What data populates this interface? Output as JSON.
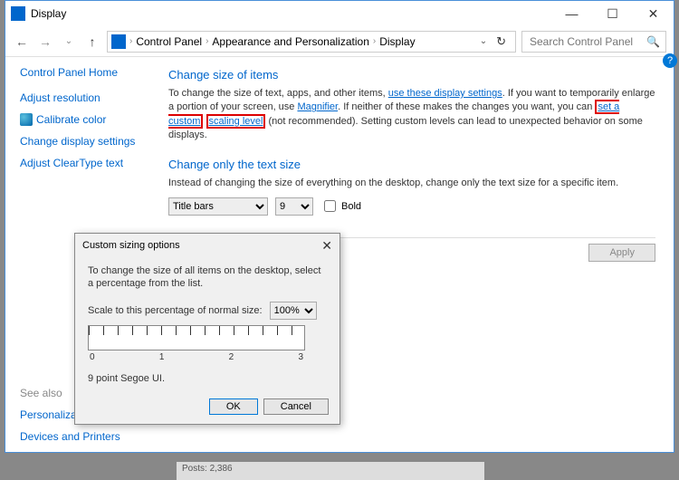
{
  "window": {
    "title": "Display"
  },
  "nav": {
    "path": [
      "Control Panel",
      "Appearance and Personalization",
      "Display"
    ],
    "search_placeholder": "Search Control Panel"
  },
  "sidebar": {
    "home": "Control Panel Home",
    "links": [
      "Adjust resolution",
      "Calibrate color",
      "Change display settings",
      "Adjust ClearType text"
    ],
    "see_also_label": "See also",
    "see_also": [
      "Personalization",
      "Devices and Printers"
    ]
  },
  "main": {
    "heading1": "Change size of items",
    "para1a": "To change the size of text, apps, and other items, ",
    "link1": "use these display settings",
    "para1b": ".  If you want to temporarily enlarge a portion of your screen, use ",
    "link2": "Magnifier",
    "para1c": ".  If neither of these makes the changes you want, you can ",
    "link3a": "set a custom",
    "link3b": "scaling level",
    "para1d": " (not recommended).  Setting custom levels can lead to unexpected behavior on some displays.",
    "heading2": "Change only the text size",
    "para2": "Instead of changing the size of everything on the desktop, change only the text size for a specific item.",
    "dropdown_item": "Title bars",
    "dropdown_size": "9",
    "bold_label": "Bold",
    "apply": "Apply"
  },
  "dialog": {
    "title": "Custom sizing options",
    "text1": "To change the size of all items on the desktop, select a percentage from the list.",
    "scale_label": "Scale to this percentage of normal size:",
    "scale_value": "100%",
    "ruler_nums": [
      "0",
      "1",
      "2",
      "3"
    ],
    "sample": "9 point Segoe UI.",
    "ok": "OK",
    "cancel": "Cancel"
  },
  "bg": {
    "posts": "Posts: 2,386"
  }
}
